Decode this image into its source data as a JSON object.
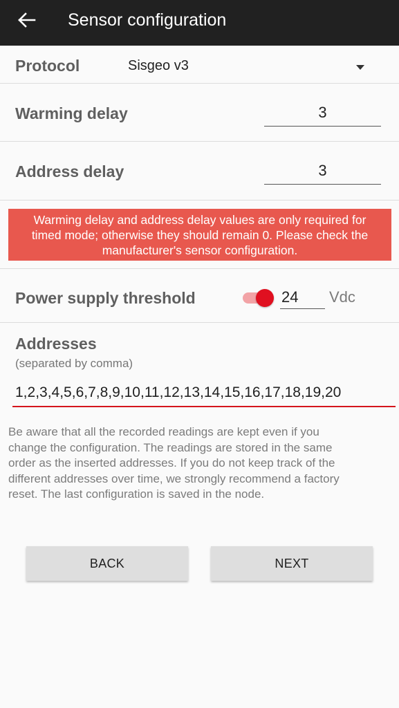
{
  "appbar": {
    "title": "Sensor configuration",
    "back_icon": "arrow-left-icon"
  },
  "protocol": {
    "label": "Protocol",
    "value": "Sisgeo v3"
  },
  "warming_delay": {
    "label": "Warming delay",
    "value": "3"
  },
  "address_delay": {
    "label": "Address delay",
    "value": "3"
  },
  "warning": {
    "line1": "Warming delay and address delay values are only required for",
    "line2": "timed mode; otherwise they should remain 0. Please check the",
    "line3": "manufacturer's sensor configuration.",
    "color": "#e8584e"
  },
  "power": {
    "label": "Power supply threshold",
    "enabled": true,
    "value": "24",
    "unit": "Vdc"
  },
  "addresses": {
    "label": "Addresses",
    "hint": "(separated by comma)",
    "value": "1,2,3,4,5,6,7,8,9,10,11,12,13,14,15,16,17,18,19,20"
  },
  "note": {
    "line1": "Be aware that all the recorded readings are kept even if you",
    "line2": "change the configuration. The readings are stored in the same",
    "line3": "order as the inserted addresses. If you do not keep track of the",
    "line4": "different addresses over time, we strongly recommend a factory",
    "line5": "reset. The last configuration is saved in the node."
  },
  "buttons": {
    "back": "BACK",
    "next": "NEXT"
  },
  "colors": {
    "appbar": "#212121",
    "accent": "#e01020"
  }
}
